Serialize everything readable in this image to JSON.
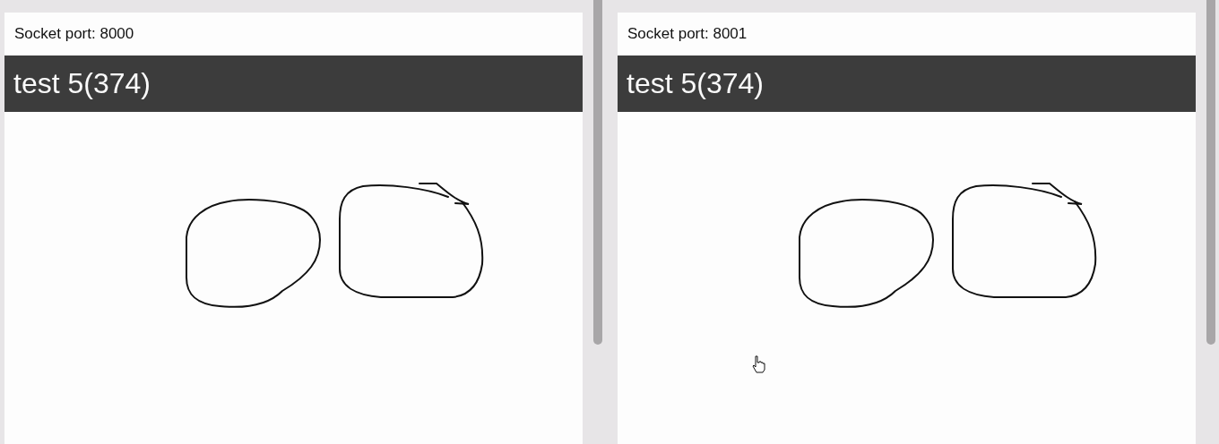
{
  "panes": [
    {
      "socket_label": "Socket port: 8000",
      "title": "test 5(374)",
      "cursor_shown": false
    },
    {
      "socket_label": "Socket port: 8001",
      "title": "test 5(374)",
      "cursor_shown": true
    }
  ]
}
